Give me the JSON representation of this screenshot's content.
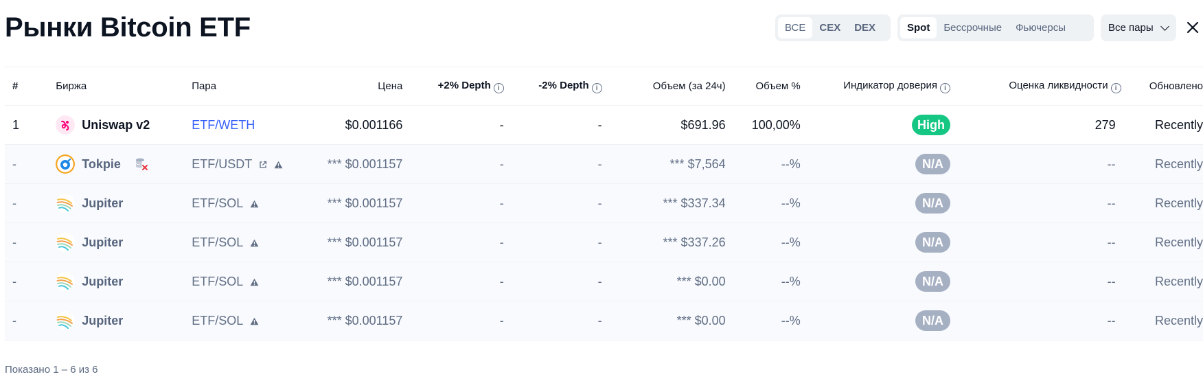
{
  "page": {
    "title": "Рынки Bitcoin ETF"
  },
  "filters": {
    "market_type": [
      "ВСЕ",
      "CEX",
      "DEX"
    ],
    "market_type_active": "ВСЕ",
    "category": [
      "Spot",
      "Бессрочные",
      "Фьючерсы"
    ],
    "category_active": "Spot",
    "pairs_dropdown": "Все пары"
  },
  "table": {
    "headers": {
      "rank": "#",
      "exchange": "Биржа",
      "pair": "Пара",
      "price": "Цена",
      "depth_plus": "+2% Depth",
      "depth_minus": "-2% Depth",
      "volume": "Объем (за 24ч)",
      "volume_pct": "Объем %",
      "confidence": "Индикатор доверия",
      "liquidity": "Оценка ликвидности",
      "updated": "Обновлено"
    },
    "rows": [
      {
        "rank": "1",
        "exchange": "Uniswap v2",
        "logo": "uniswap-logo",
        "pair": "ETF/WETH",
        "price": "$0.001166",
        "depth_plus": "-",
        "depth_minus": "-",
        "volume": "$691.96",
        "volume_pct": "100,00%",
        "confidence": "High",
        "liquidity": "279",
        "updated": "Recently"
      },
      {
        "rank": "-",
        "exchange": "Tokpie",
        "logo": "tokpie-logo",
        "pair": "ETF/USDT",
        "price": "*** $0.001157",
        "depth_plus": "-",
        "depth_minus": "-",
        "volume": "*** $7,564",
        "volume_pct": "--%",
        "confidence": "N/A",
        "liquidity": "--",
        "updated": "Recently"
      },
      {
        "rank": "-",
        "exchange": "Jupiter",
        "logo": "jupiter-logo",
        "pair": "ETF/SOL",
        "price": "*** $0.001157",
        "depth_plus": "-",
        "depth_minus": "-",
        "volume": "*** $337.34",
        "volume_pct": "--%",
        "confidence": "N/A",
        "liquidity": "--",
        "updated": "Recently"
      },
      {
        "rank": "-",
        "exchange": "Jupiter",
        "logo": "jupiter-logo",
        "pair": "ETF/SOL",
        "price": "*** $0.001157",
        "depth_plus": "-",
        "depth_minus": "-",
        "volume": "*** $337.26",
        "volume_pct": "--%",
        "confidence": "N/A",
        "liquidity": "--",
        "updated": "Recently"
      },
      {
        "rank": "-",
        "exchange": "Jupiter",
        "logo": "jupiter-logo",
        "pair": "ETF/SOL",
        "price": "*** $0.001157",
        "depth_plus": "-",
        "depth_minus": "-",
        "volume": "*** $0.00",
        "volume_pct": "--%",
        "confidence": "N/A",
        "liquidity": "--",
        "updated": "Recently"
      },
      {
        "rank": "-",
        "exchange": "Jupiter",
        "logo": "jupiter-logo",
        "pair": "ETF/SOL",
        "price": "*** $0.001157",
        "depth_plus": "-",
        "depth_minus": "-",
        "volume": "*** $0.00",
        "volume_pct": "--%",
        "confidence": "N/A",
        "liquidity": "--",
        "updated": "Recently"
      }
    ]
  },
  "footer": {
    "summary": "Показано 1 – 6 из 6"
  },
  "colors": {
    "link": "#3861fb",
    "high": "#16c784",
    "na": "#a6b0c3",
    "muted": "#616e85"
  }
}
